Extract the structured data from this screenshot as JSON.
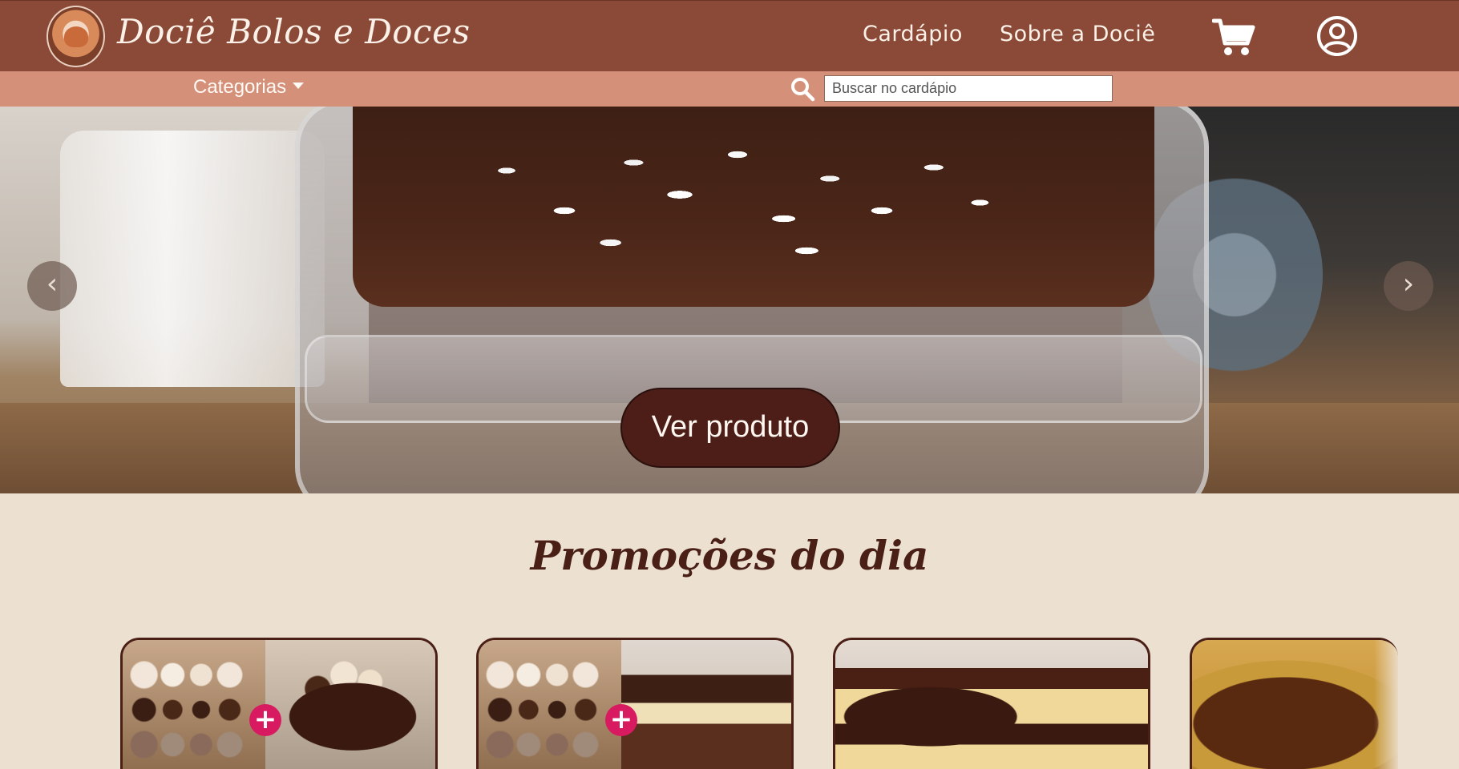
{
  "header": {
    "brand": "Dociê Bolos e Doces",
    "nav": [
      {
        "label": "Cardápio"
      },
      {
        "label": "Sobre a Dociê"
      }
    ],
    "icons": {
      "cart": "cart-icon",
      "user": "user-circle-icon",
      "search": "search-icon"
    }
  },
  "subbar": {
    "categories_label": "Categorias",
    "search_placeholder": "Buscar no cardápio"
  },
  "hero": {
    "cta_label": "Ver produto",
    "prev_symbol": "‹",
    "next_symbol": "›"
  },
  "promo": {
    "title": "Promoções do dia",
    "plus_symbol": "+"
  },
  "colors": {
    "navbar": "#8a4a37",
    "subbar": "#d5907a",
    "background": "#ece0d1",
    "cta": "#4d1e18",
    "title": "#4a1f16",
    "accent_plus": "#d81b60"
  }
}
